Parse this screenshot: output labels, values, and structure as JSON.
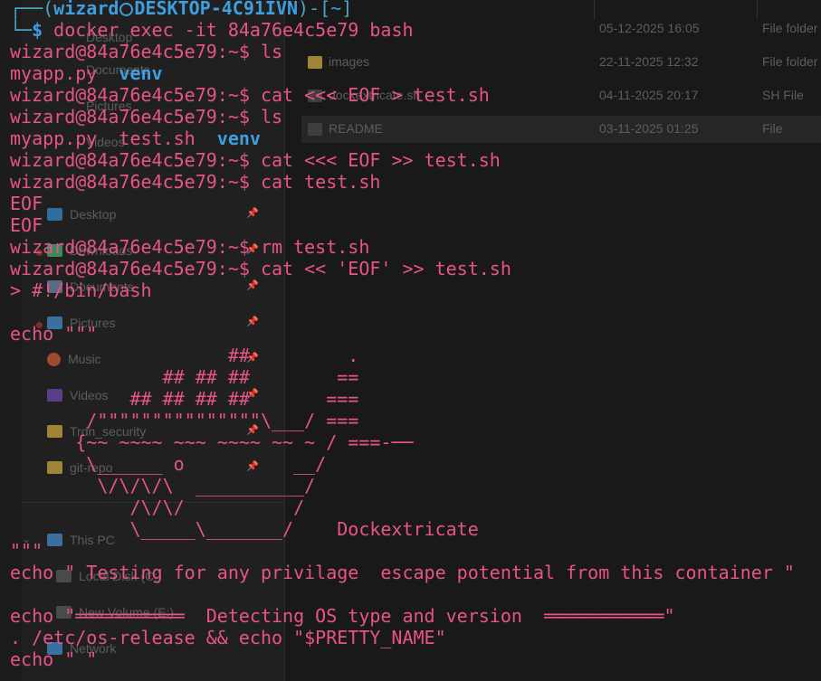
{
  "explorer": {
    "sidebar": [
      {
        "label": "Desktop",
        "icon": "desktop-folder-icon",
        "color": "#2e6e9e",
        "pinned": true
      },
      {
        "label": "Downloads",
        "icon": "downloads-folder-icon",
        "color": "#3b8a5a",
        "pinned": true
      },
      {
        "label": "Documents",
        "icon": "documents-folder-icon",
        "color": "#5a6a80",
        "pinned": true
      },
      {
        "label": "Pictures",
        "icon": "pictures-folder-icon",
        "color": "#3a6fa0",
        "pinned": true
      },
      {
        "label": "Music",
        "icon": "music-folder-icon",
        "color": "#a04a30",
        "pinned": true
      },
      {
        "label": "Videos",
        "icon": "videos-folder-icon",
        "color": "#5a3e8a",
        "pinned": true
      },
      {
        "label": "Trdn_security",
        "icon": "folder-icon",
        "color": "#a08438",
        "pinned": true
      },
      {
        "label": "git-repo",
        "icon": "folder-icon",
        "color": "#a08438",
        "pinned": true
      }
    ],
    "sidebar_bottom": [
      {
        "label": "This PC",
        "icon": "pc-icon",
        "color": "#3a6fa0"
      },
      {
        "label": "Local Disk (C:)",
        "icon": "drive-icon",
        "color": "#5d5d5d"
      },
      {
        "label": "New Volume (E:)",
        "icon": "drive-icon",
        "color": "#5d5d5d"
      },
      {
        "label": "Network",
        "icon": "network-icon",
        "color": "#3a6fa0"
      }
    ],
    "top_sidebar_fragments": [
      "Desktop",
      "Documents",
      "Pictures",
      "Videos"
    ],
    "files": [
      {
        "name": "",
        "date": "05-12-2025 16:05",
        "type": "File folder",
        "icon": "folder-icon",
        "color": "#a08438"
      },
      {
        "name": "images",
        "date": "22-11-2025 12:32",
        "type": "File folder",
        "icon": "folder-icon",
        "color": "#a08438"
      },
      {
        "name": "dockextricate.sh",
        "date": "04-11-2025 20:17",
        "type": "SH File",
        "icon": "file-icon",
        "color": "#5a5a5a"
      },
      {
        "name": "README",
        "date": "03-11-2025 01:25",
        "type": "File",
        "icon": "file-icon",
        "color": "#5a5a5a"
      }
    ]
  },
  "terminal": {
    "colors": {
      "text": "#e8538a",
      "prompt_box": "#49a6c6",
      "prompt_user": "#3f9ee0",
      "directory": "#3f9ee0"
    },
    "prompt_box": {
      "top_left": "┌──(",
      "user": "wizard",
      "host": "DESKTOP-4C91IVN",
      "sep": ")-[",
      "dir": "~",
      "close": "]",
      "bottom_left": "└─",
      "dollar": "$"
    },
    "first_command": " docker exec -it 84a76e4c5e79 bash",
    "container_prompt": "wizard@84a76e4c5e79:~$",
    "lines": {
      "l2": " ls",
      "l3a": "myapp.py  ",
      "l3b": "venv",
      "l4": " cat <<< EOF > test.sh",
      "l5": " ls",
      "l6a": "myapp.py  test.sh  ",
      "l6b": "venv",
      "l7": " cat <<< EOF >> test.sh",
      "l8": " cat test.sh",
      "l9": "EOF",
      "l10": "EOF",
      "l11": " rm test.sh",
      "l12": " cat << 'EOF' >> test.sh",
      "l13": "> #!/bin/bash",
      "l15": "echo \"\"\"",
      "art1": "                    ##         .",
      "art2": "              ## ## ##        ==",
      "art3": "           ## ## ## ##       ===",
      "art4": "       /\"\"\"\"\"\"\"\"\"\"\"\"\"\"\"\\___/ ===",
      "art5": "      {~~ ~~~~ ~~~ ~~~~ ~~ ~ / ===-──",
      "art6": "       \\______ o          __/",
      "art7": "        \\/\\/\\/\\  __________/",
      "art8": "           /\\/\\/          /",
      "art9": "           \\_____\\_______/    Dockextricate",
      "l25": "\"\"\"",
      "l26": "echo \" Testing for any privilage  escape potential from this container \"",
      "l28": "echo \"══════════  Detecting OS type and version  ═══════════\"",
      "l29": ". /etc/os-release && echo \"$PRETTY_NAME\"",
      "l30": "echo \" \""
    }
  }
}
